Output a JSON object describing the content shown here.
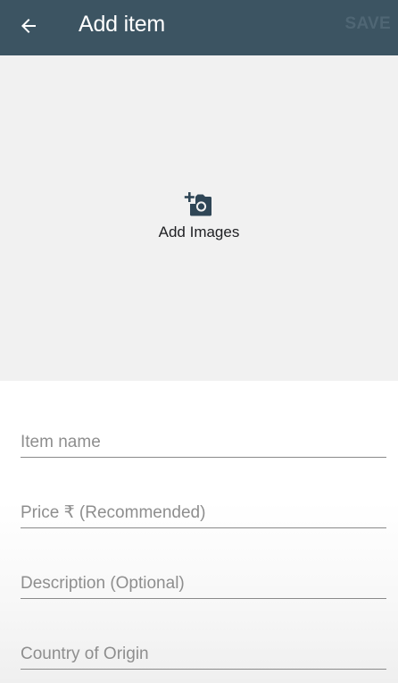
{
  "app_bar": {
    "title": "Add item",
    "save_label": "SAVE",
    "back_icon": "arrow-left-icon",
    "background_color": "#3c5462"
  },
  "image_picker": {
    "label": "Add Images",
    "icon": "add-a-photo-icon"
  },
  "form": {
    "fields": [
      {
        "placeholder": "Item name",
        "value": ""
      },
      {
        "placeholder": "Price ₹ (Recommended)",
        "value": ""
      },
      {
        "placeholder": "Description (Optional)",
        "value": ""
      },
      {
        "placeholder": "Country of Origin",
        "value": ""
      }
    ]
  }
}
